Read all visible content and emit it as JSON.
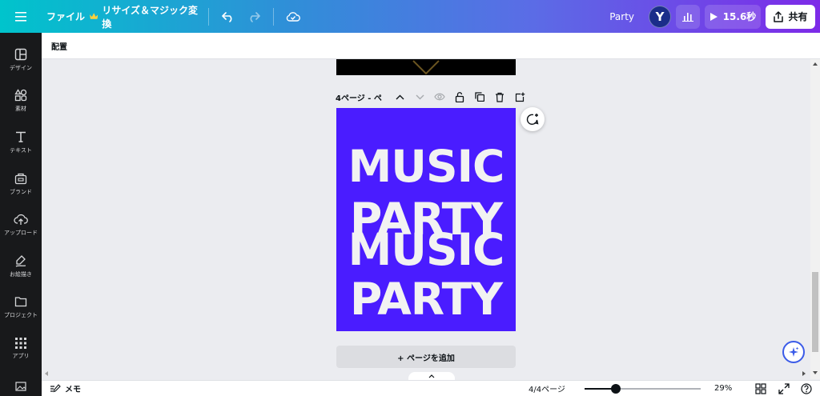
{
  "topbar": {
    "file_label": "ファイル",
    "resize_label": "リサイズ＆マジック変換",
    "title": "Party",
    "avatar_initial": "Y",
    "present_label": "15.6秒",
    "share_label": "共有"
  },
  "sidebar": {
    "items": [
      {
        "label": "デザイン",
        "icon": "design-icon"
      },
      {
        "label": "素材",
        "icon": "elements-icon"
      },
      {
        "label": "テキスト",
        "icon": "text-icon"
      },
      {
        "label": "ブランド",
        "icon": "brand-icon"
      },
      {
        "label": "アップロード",
        "icon": "upload-icon"
      },
      {
        "label": "お絵描き",
        "icon": "draw-icon"
      },
      {
        "label": "プロジェクト",
        "icon": "projects-icon"
      },
      {
        "label": "アプリ",
        "icon": "apps-icon"
      }
    ]
  },
  "subheader": {
    "label": "配置"
  },
  "canvas": {
    "page_label": "4ページ - ペ",
    "poster": {
      "line1": "MUSIC",
      "line2": "PARTY",
      "line3": "MUSIC",
      "line4": "PARTY",
      "bg_color": "#4a1cff",
      "text_color": "#f2f2f2"
    },
    "add_page_label": "+ ページを追加"
  },
  "footer": {
    "notes_label": "メモ",
    "page_count": "4/4ページ",
    "zoom_percent": 29,
    "zoom_label": "29%"
  },
  "colors": {
    "accent": "#7d2ae8",
    "sidebar_bg": "#18191b"
  }
}
